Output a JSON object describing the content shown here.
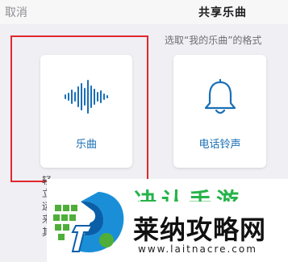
{
  "nav": {
    "cancel_label": "取消",
    "title": "共享乐曲"
  },
  "subtitle": "选取“我的乐曲”的格式",
  "cards": [
    {
      "label": "乐曲",
      "icon": "waveform-icon"
    },
    {
      "label": "电话铃声",
      "icon": "bell-icon"
    }
  ],
  "description_chars": [
    "轻",
    "立",
    "运",
    "来",
    "其"
  ],
  "watermark": {
    "brand": "莱纳攻略网",
    "url": "www.laitnacre.com",
    "top_text": "决认手游"
  },
  "colors": {
    "accent": "#1a6fb5",
    "highlight": "#e0282e",
    "brand_green": "#26b34a"
  }
}
